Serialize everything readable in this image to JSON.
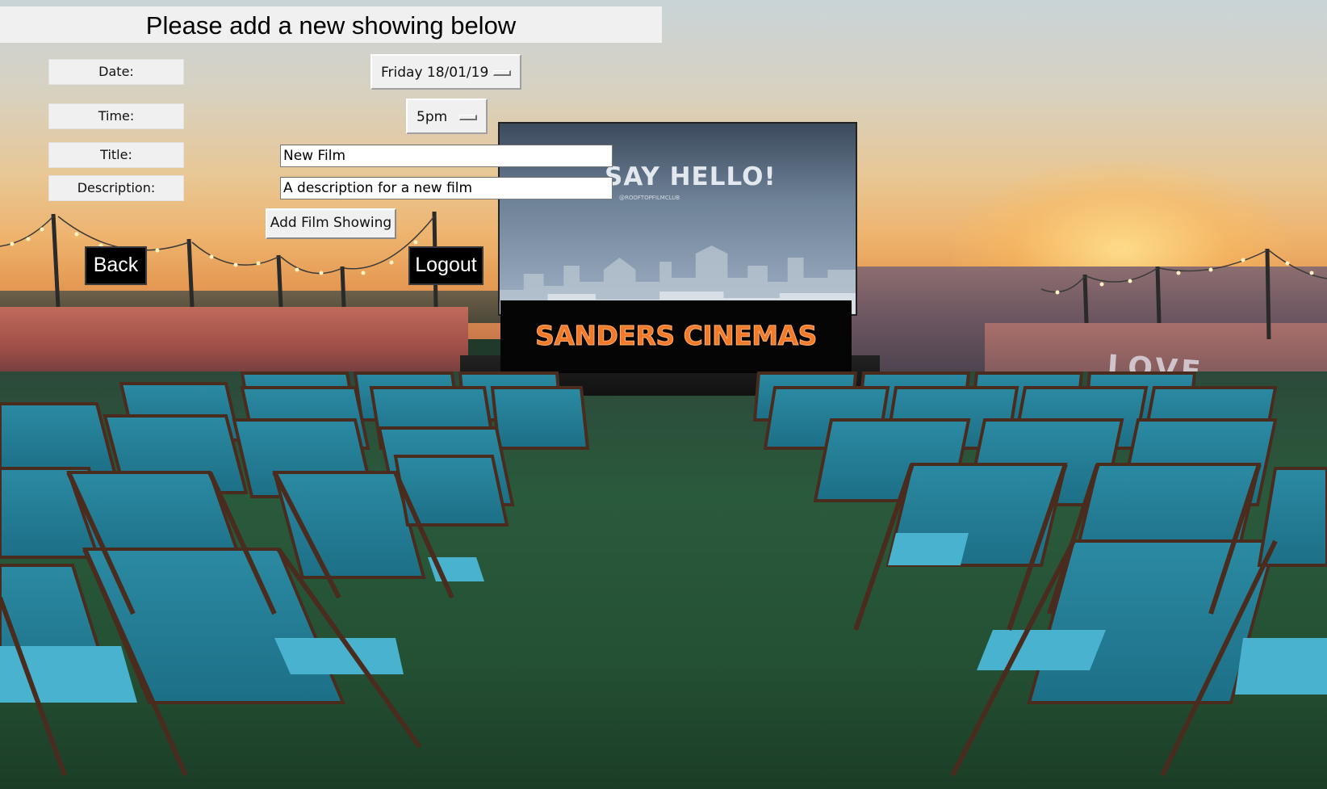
{
  "form": {
    "heading": "Please add a new showing below",
    "labels": {
      "date": "Date:",
      "time": "Time:",
      "title": "Title:",
      "description": "Description:"
    },
    "date_select": {
      "selected": "Friday 18/01/19"
    },
    "time_select": {
      "selected": "5pm"
    },
    "title_input": {
      "value": "New Film"
    },
    "description_input": {
      "value": "A description for a new film"
    },
    "add_button_label": "Add Film Showing"
  },
  "nav": {
    "back_label": "Back",
    "logout_label": "Logout"
  },
  "background": {
    "screen_title": "SAY HELLO!",
    "screen_subtitle": "@ROOFTOPFILMCLUB",
    "brand": "SANDERS CINEMAS",
    "wall_text": "LOVE PEACE"
  }
}
